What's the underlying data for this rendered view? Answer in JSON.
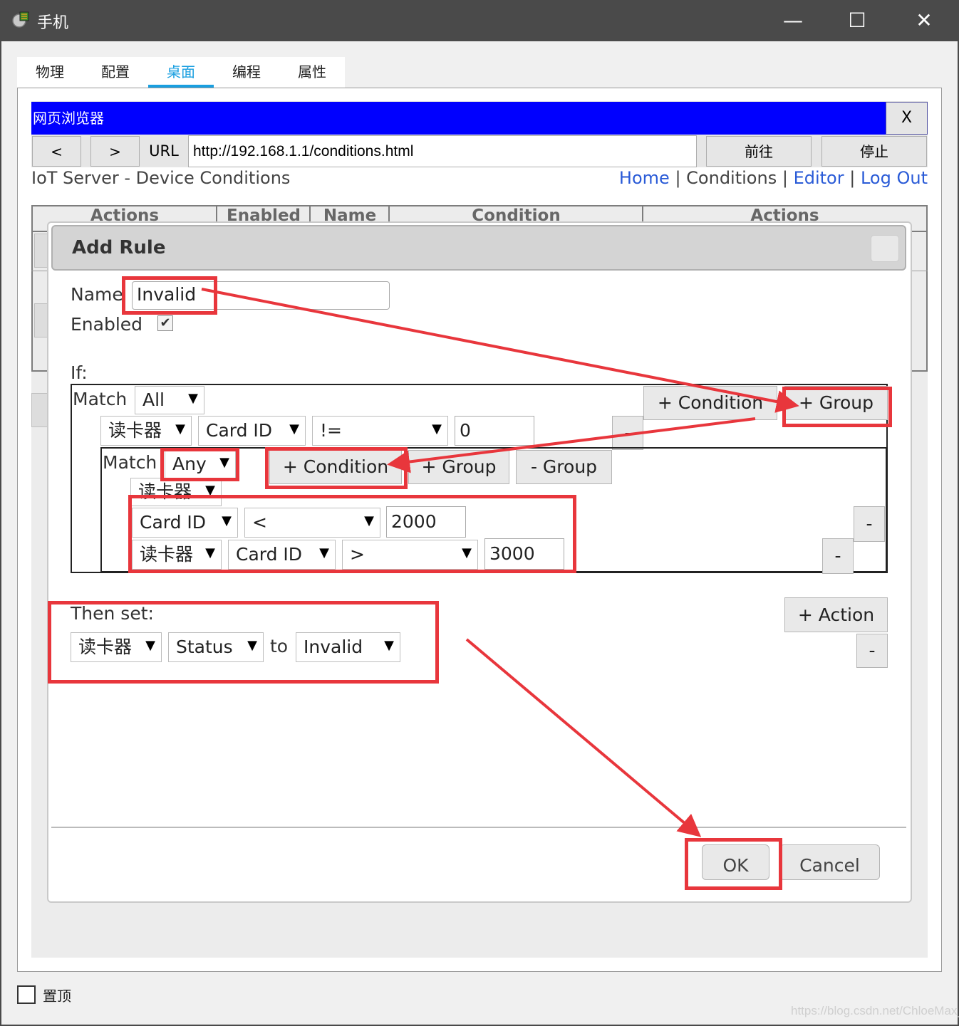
{
  "window": {
    "title": "手机",
    "icon": "phone-app-icon",
    "controls": [
      "minimize-icon",
      "maximize-icon",
      "close-icon"
    ]
  },
  "tabs": [
    {
      "label": "物理",
      "active": false
    },
    {
      "label": "配置",
      "active": false
    },
    {
      "label": "桌面",
      "active": true
    },
    {
      "label": "编程",
      "active": false
    },
    {
      "label": "属性",
      "active": false
    }
  ],
  "browser": {
    "title": "网页浏览器",
    "close_label": "X",
    "back_label": "<",
    "forward_label": ">",
    "url_label": "URL",
    "url": "http://192.168.1.1/conditions.html",
    "go_label": "前往",
    "stop_label": "停止"
  },
  "page": {
    "title": "IoT Server - Device Conditions",
    "nav": {
      "home": "Home",
      "sep": "|",
      "conditions": "Conditions",
      "editor": "Editor",
      "logout": "Log Out"
    },
    "table_headers": [
      "Actions",
      "Enabled",
      "Name",
      "Condition",
      "Actions"
    ]
  },
  "dialog": {
    "title": "Add Rule",
    "name_label": "Name",
    "name_value": "Invalid",
    "enabled_label": "Enabled",
    "enabled_checked": true,
    "if_label": "If:",
    "outer_group": {
      "match_label": "Match",
      "match_value": "All",
      "add_condition_label": "+ Condition",
      "add_group_label": "+ Group",
      "condition": {
        "device": "读卡器",
        "property": "Card ID",
        "operator": "!=",
        "value": "0",
        "remove_label": "-"
      }
    },
    "inner_group": {
      "match_label": "Match",
      "match_value": "Any",
      "add_condition_label": "+ Condition",
      "add_group_label": "+ Group",
      "remove_group_label": "- Group",
      "conditions": [
        {
          "device": "读卡器",
          "property": "Card ID",
          "operator": "<",
          "value": "2000",
          "remove_label": "-"
        },
        {
          "device": "读卡器",
          "property": "Card ID",
          "operator": ">",
          "value": "3000",
          "remove_label": "-"
        }
      ]
    },
    "then_label": "Then set:",
    "action": {
      "device": "读卡器",
      "property": "Status",
      "to_label": "to",
      "value": "Invalid"
    },
    "add_action_label": "+ Action",
    "remove_action_label": "-",
    "ok_label": "OK",
    "cancel_label": "Cancel"
  },
  "footer": {
    "pin_label": "置顶",
    "watermark": "https://blog.csdn.net/ChloeMax_"
  },
  "colors": {
    "annotation": "#e8363c",
    "browser_header": "#0000ff",
    "link": "#2a5bd7",
    "active_tab": "#1a9fe0"
  }
}
